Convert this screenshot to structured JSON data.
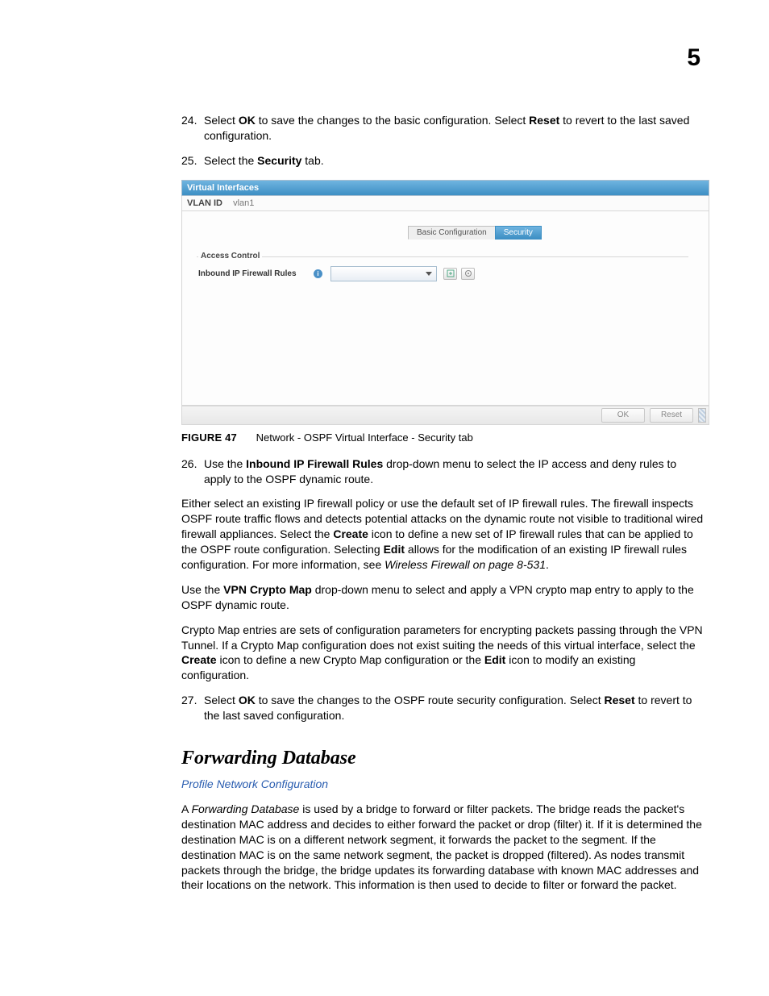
{
  "page_number": "5",
  "steps": {
    "s24_num": "24.",
    "s24": "Select <b>OK</b> to save the changes to the basic configuration. Select <b>Reset</b> to revert to the last saved configuration.",
    "s25_num": "25.",
    "s25": "Select the <b>Security</b> tab.",
    "s26_num": "26.",
    "s26": "Use the <b>Inbound IP Firewall Rules</b> drop-down menu to select the IP access and deny rules to apply to the OSPF dynamic route.",
    "s27_num": "27.",
    "s27": "Select <b>OK</b> to save the changes to the OSPF route security configuration. Select <b>Reset</b> to revert to the last saved configuration."
  },
  "screenshot": {
    "header": "Virtual Interfaces",
    "vlan_label": "VLAN ID",
    "vlan_value": "vlan1",
    "tab_basic": "Basic Configuration",
    "tab_security": "Security",
    "fieldset": "Access Control",
    "control_label": "Inbound IP Firewall Rules",
    "ok": "OK",
    "reset": "Reset"
  },
  "figure": {
    "label": "FIGURE 47",
    "text": "Network - OSPF Virtual Interface - Security tab"
  },
  "paragraphs": {
    "p1": "Either select an existing IP firewall policy or use the default set of IP firewall rules. The firewall inspects OSPF route traffic flows and detects potential attacks on the dynamic route not visible to traditional wired firewall appliances. Select the <b>Create</b> icon to define a new set of IP firewall rules that can be applied to the OSPF route configuration. Selecting <b>Edit</b> allows for the modification of an existing IP firewall rules configuration. For more information, see <i>Wireless Firewall on page 8-531</i>.",
    "p2": "Use the <b>VPN Crypto Map</b> drop-down menu to select and apply a VPN crypto map entry to apply to the OSPF dynamic route.",
    "p3": "Crypto Map entries are sets of configuration parameters for encrypting packets passing through the VPN Tunnel. If a Crypto Map configuration does not exist suiting the needs of this virtual interface, select the <b>Create</b> icon to define a new Crypto Map configuration or the <b>Edit</b> icon to modify an existing configuration."
  },
  "section_heading": "Forwarding Database",
  "subsection_link": "Profile Network Configuration",
  "section_body": "A <i>Forwarding Database</i> is used by a bridge to forward or filter packets. The bridge reads the packet's destination MAC address and decides to either forward the packet or drop (filter) it. If it is determined the destination MAC is on a different network segment, it forwards the packet to the segment. If the destination MAC is on the same network segment, the packet is dropped (filtered). As nodes transmit packets through the bridge, the bridge updates its forwarding database with known MAC addresses and their locations on the network. This information is then used to decide to filter or forward the packet."
}
